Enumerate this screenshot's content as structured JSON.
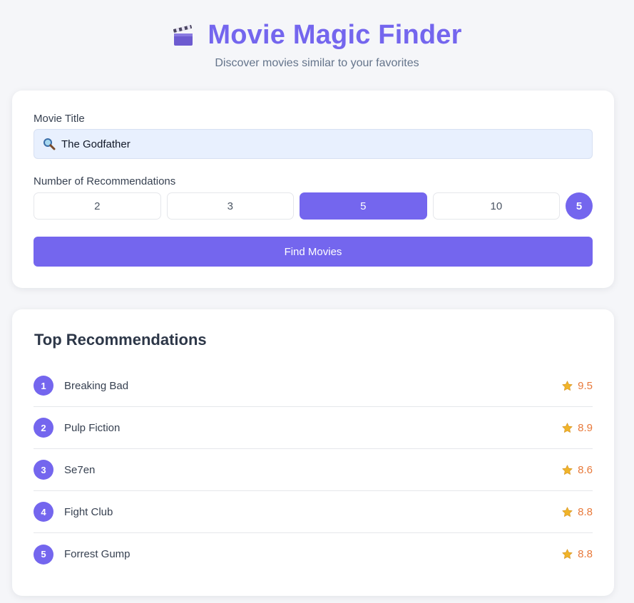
{
  "header": {
    "icon": "clapperboard-icon",
    "title": "Movie Magic Finder",
    "subtitle": "Discover movies similar to your favorites"
  },
  "search": {
    "label": "Movie Title",
    "value": "The Godfather",
    "icon": "magnifier-icon"
  },
  "recommendations_count": {
    "label": "Number of Recommendations",
    "options": [
      "2",
      "3",
      "5",
      "10"
    ],
    "selected": "5",
    "badge": "5"
  },
  "find_button": {
    "label": "Find Movies"
  },
  "results": {
    "title": "Top Recommendations",
    "items": [
      {
        "rank": "1",
        "title": "Breaking Bad",
        "rating": "9.5"
      },
      {
        "rank": "2",
        "title": "Pulp Fiction",
        "rating": "8.9"
      },
      {
        "rank": "3",
        "title": "Se7en",
        "rating": "8.6"
      },
      {
        "rank": "4",
        "title": "Fight Club",
        "rating": "8.8"
      },
      {
        "rank": "5",
        "title": "Forrest Gump",
        "rating": "8.8"
      }
    ]
  },
  "colors": {
    "accent": "#7466ee",
    "rating_text": "#e8793a",
    "star": "#f0b429",
    "background": "#f5f6f9"
  }
}
